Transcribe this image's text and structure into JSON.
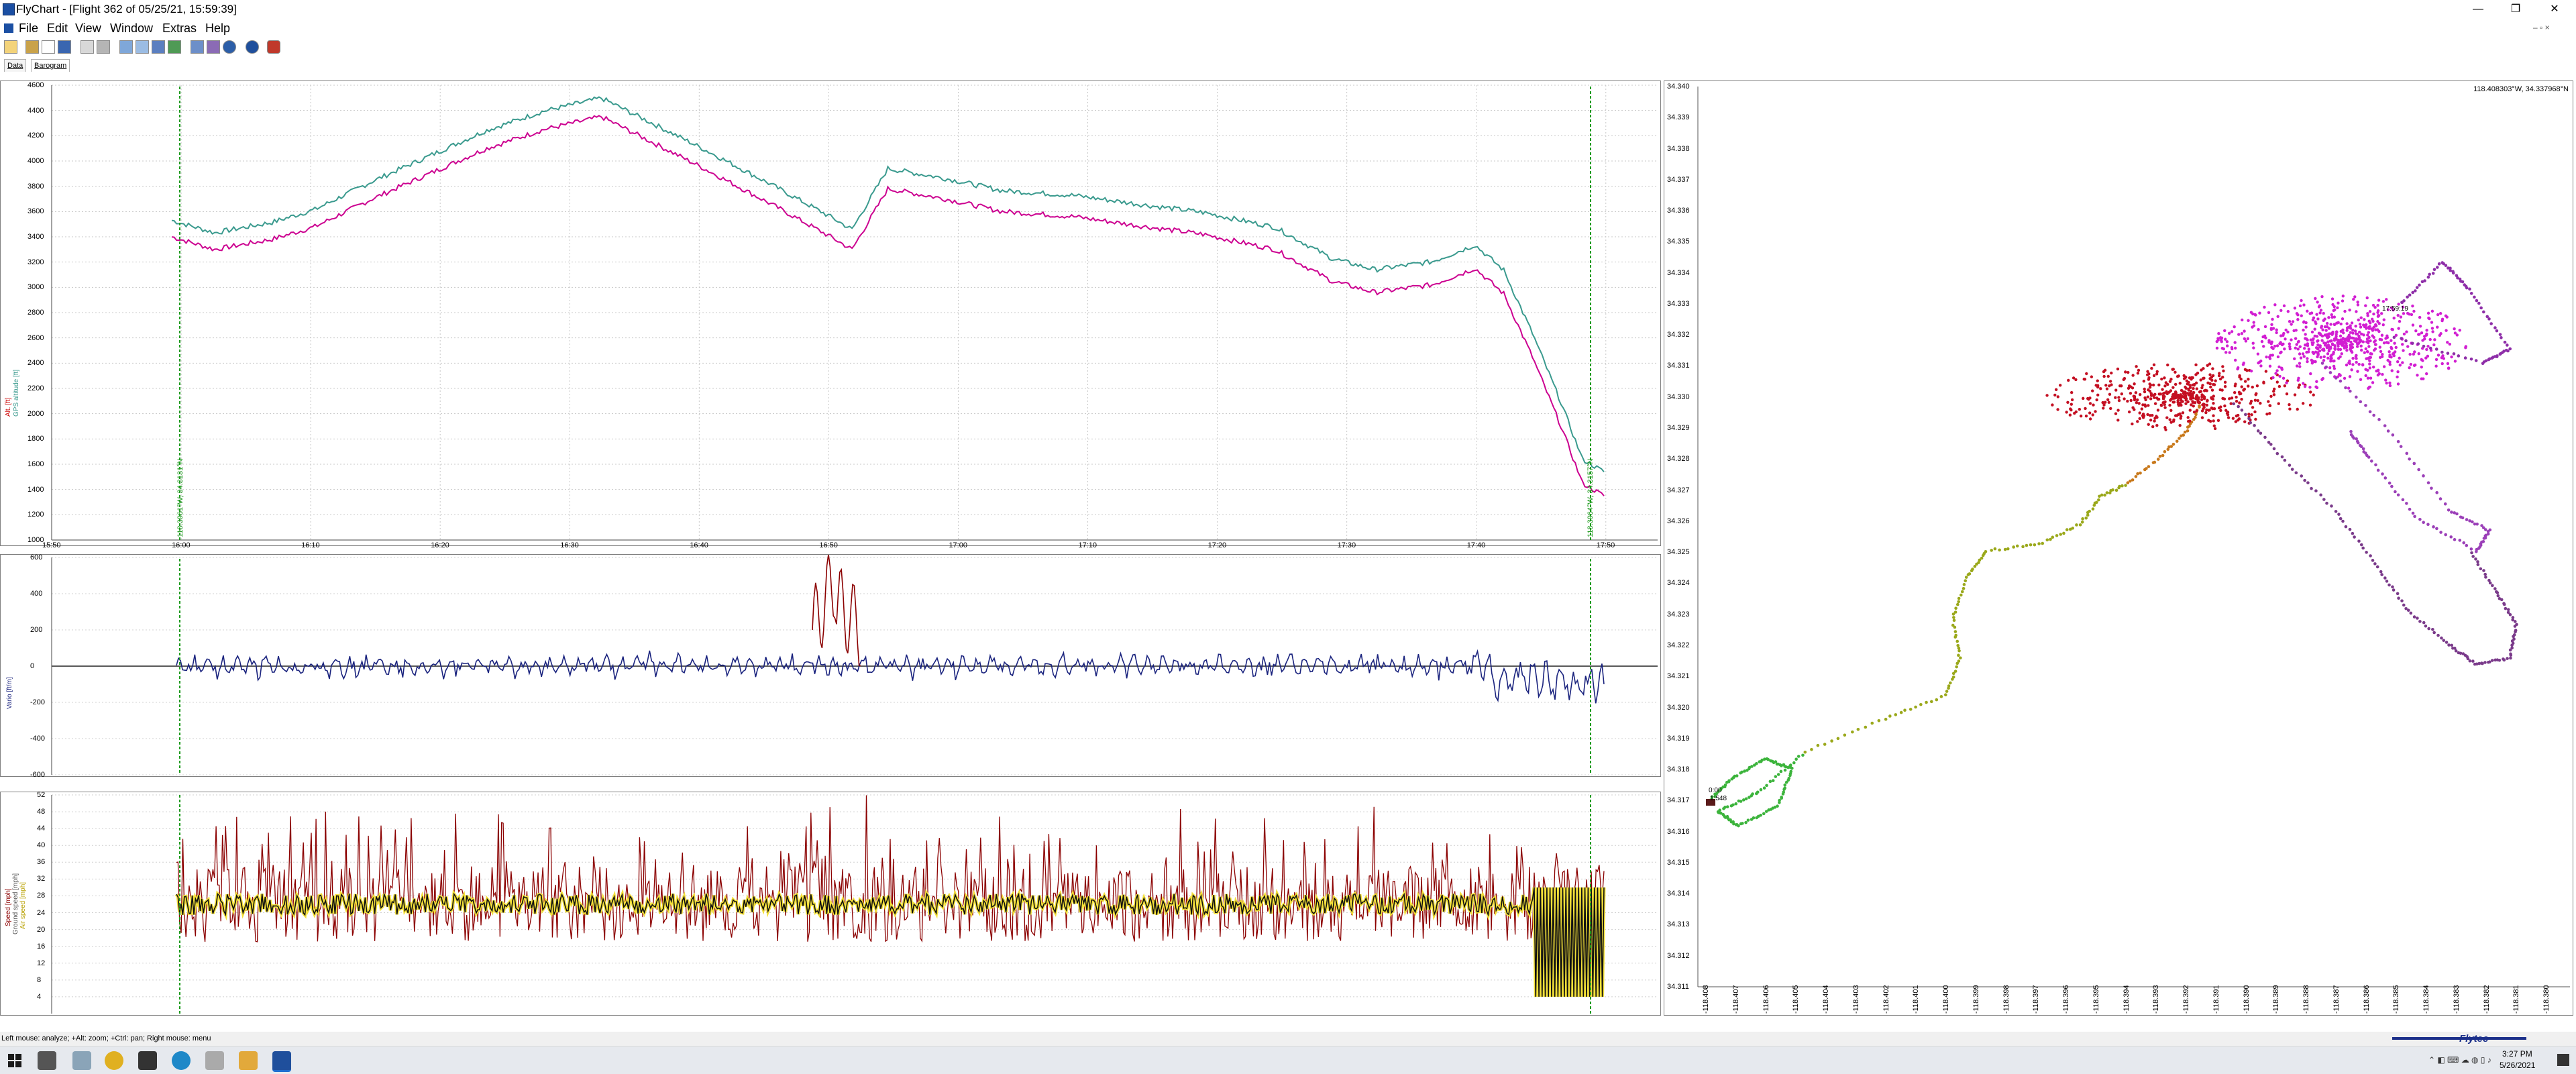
{
  "window": {
    "title": "FlyChart - [Flight 362 of 05/25/21, 15:59:39]",
    "controls": {
      "minimize": "—",
      "restore": "❐",
      "close": "✕"
    }
  },
  "menu": [
    "File",
    "Edit",
    "View",
    "Window",
    "Extras",
    "Help"
  ],
  "toolbar": {
    "buttons": [
      "open-icon",
      "folder-icon",
      "new-icon",
      "save-icon",
      "print-icon",
      "printer-setup-icon",
      "import-icon",
      "export-icon",
      "layout-icon",
      "chart-icon",
      "zoom-icon",
      "analyze-icon",
      "globe-icon",
      "help-icon",
      "flytec-icon"
    ]
  },
  "tabs": [
    "Data",
    "Barogram"
  ],
  "altitude_chart": {
    "y_axis_label_1": "Alt. [ft]",
    "y_axis_label_2": "GPS altitude [ft]",
    "y_ticks": [
      "4600",
      "4400",
      "4200",
      "4000",
      "3800",
      "3600",
      "3400",
      "3200",
      "3000",
      "2800",
      "2600",
      "2400",
      "2200",
      "2000",
      "1800",
      "1600",
      "1400",
      "1200",
      "1000"
    ],
    "x_ticks": [
      "15:50",
      "16:00",
      "16:10",
      "16:20",
      "16:30",
      "16:40",
      "16:50",
      "17:00",
      "17:10",
      "17:20",
      "17:30",
      "17:40",
      "17:50"
    ],
    "marker_start_label": "118.3961°W, 34.3131°N",
    "marker_end_label": "118.3964°W, 34.3157°N"
  },
  "vario_chart": {
    "y_axis_label": "Vario [ft/m]",
    "y_ticks": [
      "600",
      "400",
      "200",
      "0",
      "-200",
      "-400",
      "-600"
    ]
  },
  "speed_chart": {
    "y_axis_label_1": "Speed [mph]",
    "y_axis_label_2": "Ground speed [mph]",
    "y_axis_label_3": "Air speed [mph]",
    "y_ticks": [
      "52",
      "48",
      "44",
      "40",
      "36",
      "32",
      "28",
      "24",
      "20",
      "16",
      "12",
      "8",
      "4"
    ]
  },
  "map": {
    "coordinate_readout": "118.408303°W, 34.337968°N",
    "lat_ticks": [
      "34.340",
      "34.339",
      "34.338",
      "34.337",
      "34.336",
      "34.335",
      "34.334",
      "34.333",
      "34.332",
      "34.331",
      "34.330",
      "34.329",
      "34.328",
      "34.327",
      "34.326",
      "34.325",
      "34.324",
      "34.323",
      "34.322",
      "34.321",
      "34.320",
      "34.319",
      "34.318",
      "34.317",
      "34.316",
      "34.315",
      "34.314",
      "34.313",
      "34.312",
      "34.311"
    ],
    "lon_ticks": [
      "-118.408",
      "-118.407",
      "-118.406",
      "-118.405",
      "-118.404",
      "-118.403",
      "-118.402",
      "-118.401",
      "-118.400",
      "-118.399",
      "-118.398",
      "-118.397",
      "-118.396",
      "-118.395",
      "-118.394",
      "-118.393",
      "-118.392",
      "-118.391",
      "-118.390",
      "-118.389",
      "-118.388",
      "-118.387",
      "-118.386",
      "-118.385",
      "-118.384",
      "-118.383",
      "-118.382",
      "-118.381",
      "-118.380"
    ],
    "launch_label": "0:00",
    "landing_label": "1:548",
    "end_label": "17:59:19"
  },
  "status": {
    "hint": "Left mouse: analyze; +Alt: zoom; +Ctrl: pan; Right mouse: menu",
    "logo": "Flytec"
  },
  "taskbar": {
    "time": "3:27 PM",
    "date": "5/26/2021"
  }
}
